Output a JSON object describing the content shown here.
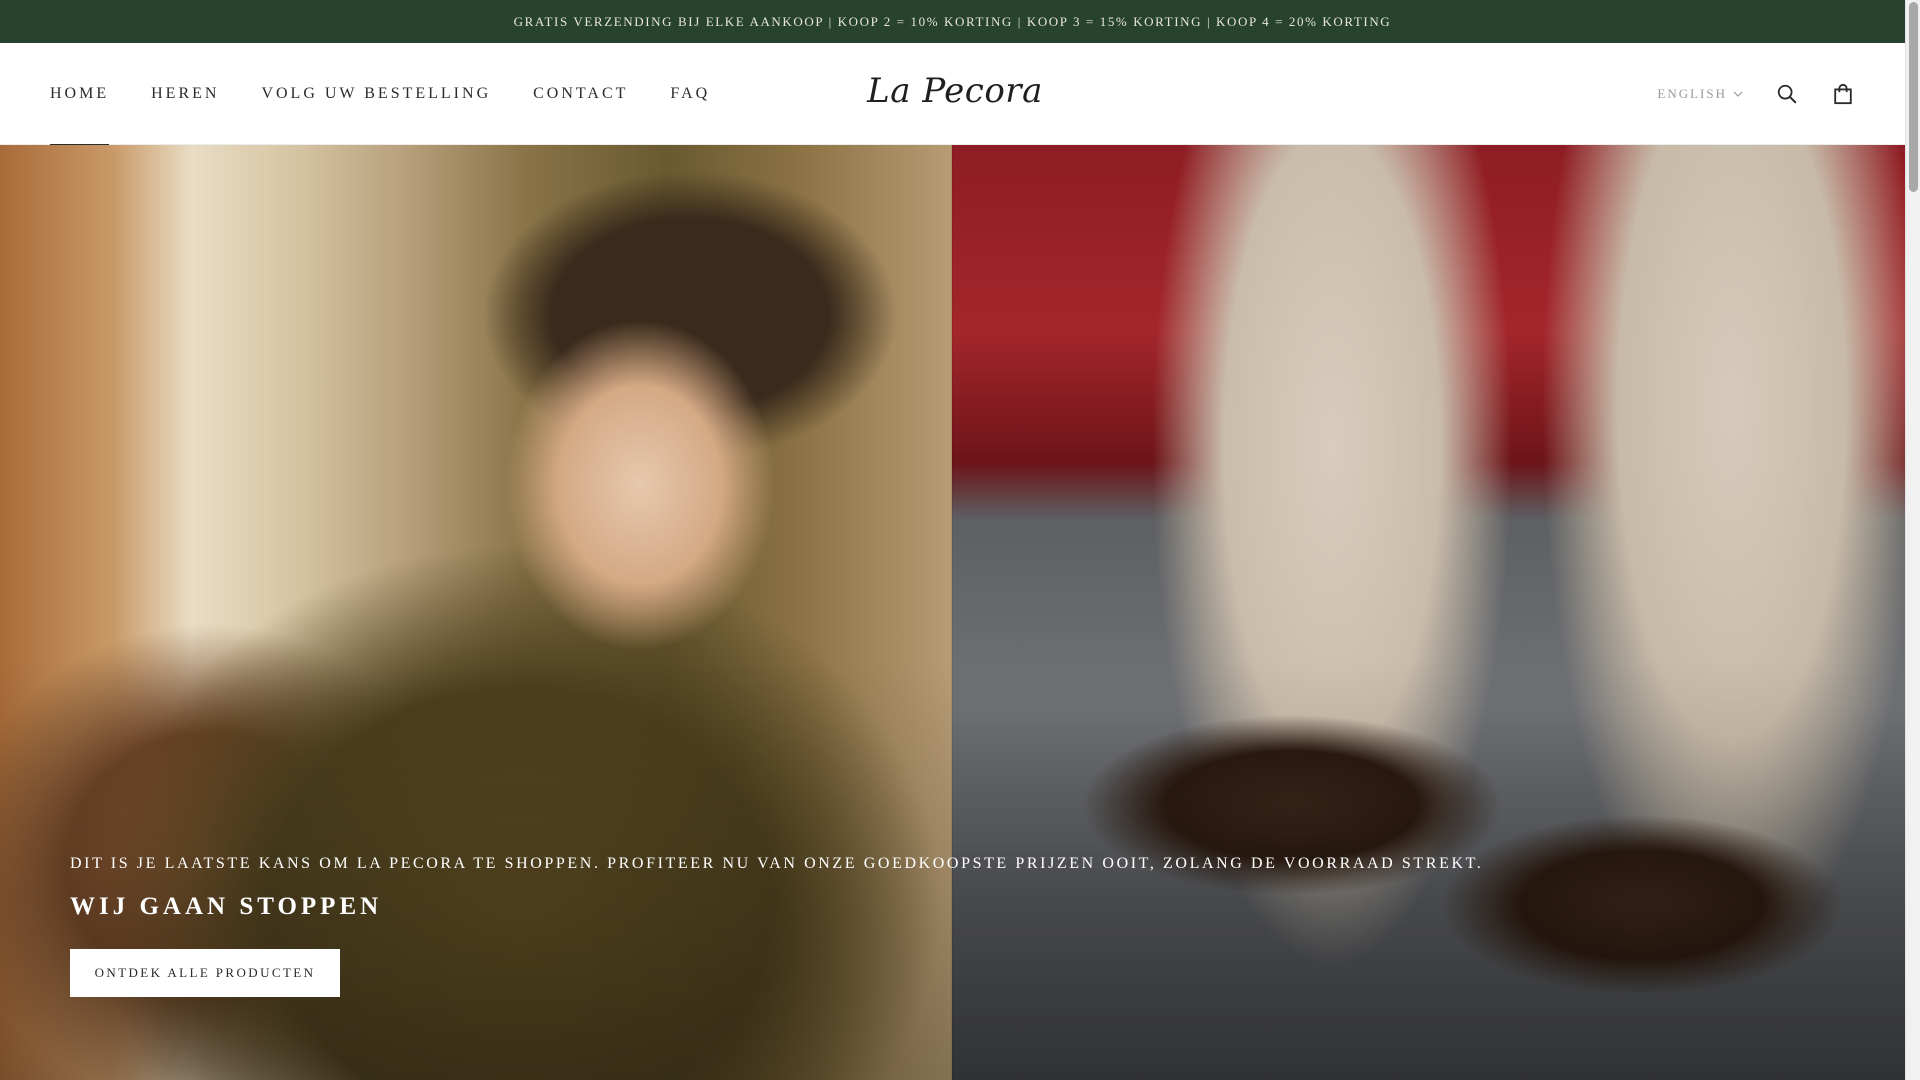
{
  "announcement": {
    "text": "Gratis verzending bij elke aankoop | Koop 2 = 10% korting | Koop 3 = 15% korting | Koop 4 = 20% korting"
  },
  "header": {
    "logo_text": "La Pecora",
    "nav": [
      {
        "label": "Home",
        "active": true
      },
      {
        "label": "Heren",
        "active": false
      },
      {
        "label": "Volg uw bestelling",
        "active": false
      },
      {
        "label": "Contact",
        "active": false
      },
      {
        "label": "FAQ",
        "active": false
      }
    ],
    "language": "English",
    "icons": {
      "search": "search-icon",
      "cart": "shopping-bag-icon",
      "language_caret": "chevron-down-icon"
    }
  },
  "hero": {
    "subtitle": "Dit is je laatste kans om La Pecora te shoppen. Profiteer nu van onze goedkoopste prijzen ooit, zolang de voorraad strekt.",
    "title": "Wij gaan stoppen",
    "button_label": "Ontdek alle producten"
  },
  "colors": {
    "announcement_bg": "#27432f",
    "announcement_text": "#e9e6d8",
    "header_bg": "#ffffff",
    "nav_text": "#2b2b2b",
    "button_bg": "#ffffff"
  }
}
